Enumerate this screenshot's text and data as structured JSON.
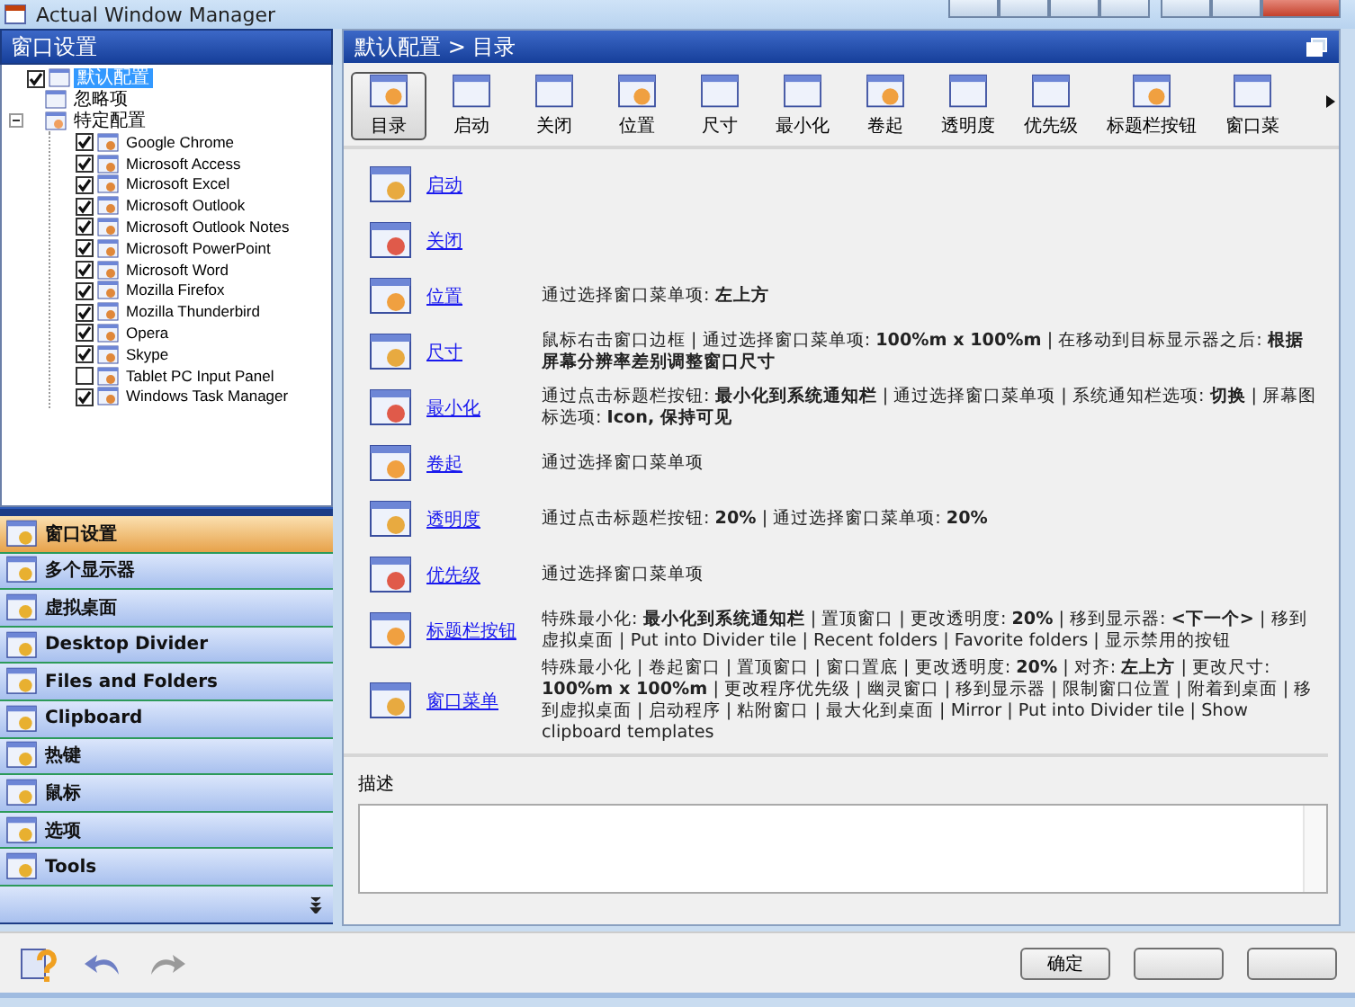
{
  "window": {
    "title": "Actual Window Manager"
  },
  "left_panel": {
    "title": "窗口设置",
    "tree": [
      {
        "label": "默认配置",
        "kind": "checkbox",
        "checked": true,
        "selected": true
      },
      {
        "label": "忽略项",
        "kind": "plain",
        "selected": false
      },
      {
        "label": "特定配置",
        "kind": "plain",
        "selected": false,
        "expanded": true,
        "children": [
          {
            "label": "Google Chrome",
            "kind": "checkbox",
            "checked": true,
            "selected": false
          },
          {
            "label": "Microsoft Access",
            "kind": "checkbox",
            "checked": true,
            "selected": false
          },
          {
            "label": "Microsoft Excel",
            "kind": "checkbox",
            "checked": true,
            "selected": false
          },
          {
            "label": "Microsoft Outlook",
            "kind": "checkbox",
            "checked": true,
            "selected": false
          },
          {
            "label": "Microsoft Outlook Notes",
            "kind": "checkbox",
            "checked": true,
            "selected": false
          },
          {
            "label": "Microsoft PowerPoint",
            "kind": "checkbox",
            "checked": true,
            "selected": false
          },
          {
            "label": "Microsoft Word",
            "kind": "checkbox",
            "checked": true,
            "selected": false
          },
          {
            "label": "Mozilla Firefox",
            "kind": "checkbox",
            "checked": true,
            "selected": false
          },
          {
            "label": "Mozilla Thunderbird",
            "kind": "checkbox",
            "checked": true,
            "selected": false
          },
          {
            "label": "Opera",
            "kind": "checkbox",
            "checked": true,
            "selected": false
          },
          {
            "label": "Skype",
            "kind": "checkbox",
            "checked": true,
            "selected": false
          },
          {
            "label": "Tablet PC Input Panel",
            "kind": "checkbox",
            "checked": false,
            "selected": false
          },
          {
            "label": "Windows Task Manager",
            "kind": "checkbox",
            "checked": true,
            "selected": false
          }
        ]
      }
    ]
  },
  "nav": {
    "items": [
      {
        "label": "窗口设置",
        "selected": true
      },
      {
        "label": "多个显示器",
        "selected": false
      },
      {
        "label": "虚拟桌面",
        "selected": false
      },
      {
        "label": "Desktop Divider",
        "selected": false
      },
      {
        "label": "Files and Folders",
        "selected": false
      },
      {
        "label": "Clipboard",
        "selected": false
      },
      {
        "label": "热键",
        "selected": false
      },
      {
        "label": "鼠标",
        "selected": false
      },
      {
        "label": "选项",
        "selected": false
      },
      {
        "label": "Tools",
        "selected": false
      }
    ]
  },
  "right_panel": {
    "breadcrumb": "默认配置 > 目录",
    "toolbar": [
      {
        "label": "目录",
        "selected": true
      },
      {
        "label": "启动",
        "selected": false
      },
      {
        "label": "关闭",
        "selected": false
      },
      {
        "label": "位置",
        "selected": false
      },
      {
        "label": "尺寸",
        "selected": false
      },
      {
        "label": "最小化",
        "selected": false
      },
      {
        "label": "卷起",
        "selected": false
      },
      {
        "label": "透明度",
        "selected": false
      },
      {
        "label": "优先级",
        "selected": false
      },
      {
        "label": "标题栏按钮",
        "selected": false
      },
      {
        "label": "窗口菜",
        "selected": false
      }
    ],
    "entries": [
      {
        "link": "启动"
      },
      {
        "link": "关闭"
      },
      {
        "link": "位置",
        "description": "通过选择窗口菜单项: **左上方**"
      },
      {
        "link": "尺寸",
        "description": "鼠标右击窗口边框 | 通过选择窗口菜单项: **100%m x 100%m** | 在移动到目标显示器之后: **根据屏幕分辨率差别调整窗口尺寸**"
      },
      {
        "link": "最小化",
        "description": "通过点击标题栏按钮: **最小化到系统通知栏** | 通过选择窗口菜单项 | 系统通知栏选项: **切换** | 屏幕图标选项: **Icon, 保持可见**"
      },
      {
        "link": "卷起",
        "description": "通过选择窗口菜单项"
      },
      {
        "link": "透明度",
        "description": "通过点击标题栏按钮: **20%** | 通过选择窗口菜单项: **20%**"
      },
      {
        "link": "优先级",
        "description": "通过选择窗口菜单项"
      },
      {
        "link": "标题栏按钮",
        "description": "特殊最小化: **最小化到系统通知栏** | 置顶窗口 | 更改透明度: **20%** | 移到显示器: **<下一个>** | 移到虚拟桌面 | Put into Divider tile | Recent folders | Favorite folders | 显示禁用的按钮"
      },
      {
        "link": "窗口菜单",
        "description": "特殊最小化 | 卷起窗口 | 置顶窗口 | 窗口置底 | 更改透明度: **20%** | 对齐: **左上方** | 更改尺寸: **100%m x 100%m** | 更改程序优先级 | 幽灵窗口 | 移到显示器 | 限制窗口位置 | 附着到桌面 | 移到虚拟桌面 | 启动程序 | 粘附窗口 | 最大化到桌面 | Mirror | Put into Divider tile | Show clipboard templates"
      }
    ]
  },
  "description": {
    "label": "描述"
  },
  "buttons": [
    {
      "kind": "labeled",
      "label": "确定"
    },
    {
      "kind": "blank"
    },
    {
      "kind": "blank"
    }
  ]
}
